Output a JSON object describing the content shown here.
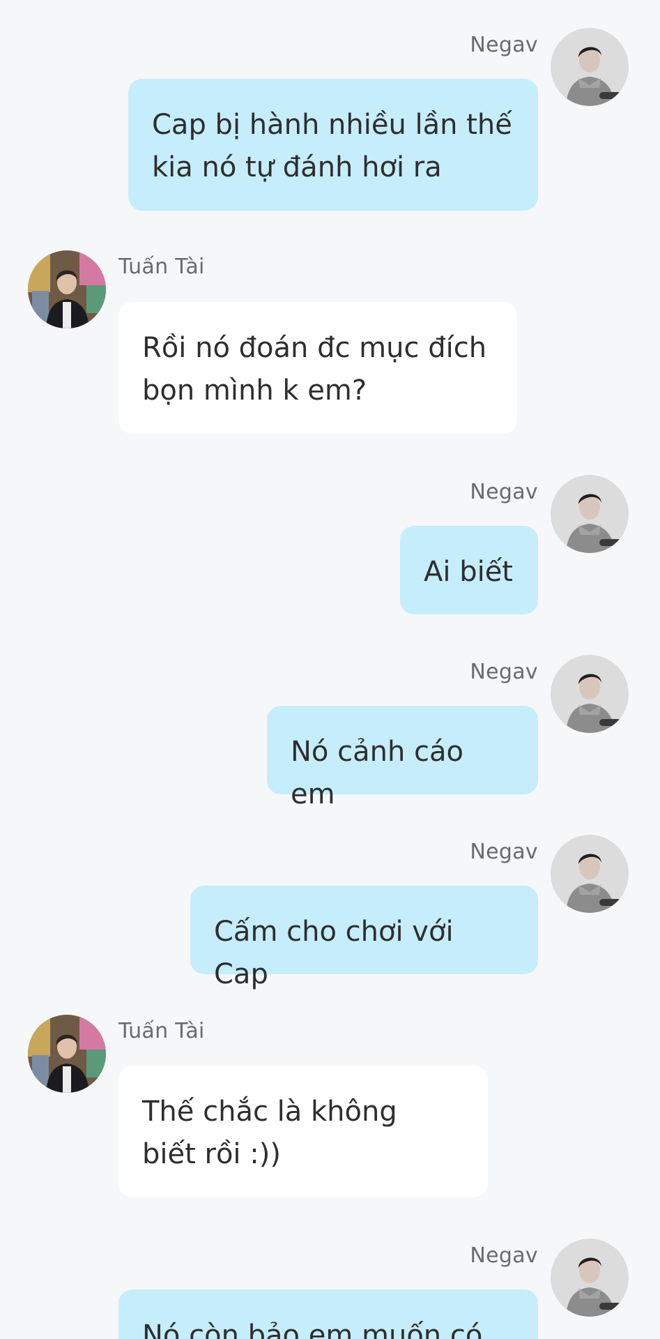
{
  "app": {
    "colors": {
      "background": "#f6f7f9",
      "outgoing_bubble": "#c6edfb",
      "incoming_bubble": "#ffffff",
      "sender_name": "#6a6a6a"
    }
  },
  "messages": [
    {
      "sender": "Negav",
      "direction": "outgoing",
      "avatar": "avatar-negav-icon",
      "text": "Cap bị hành nhiều lần thế\nkia nó tự đánh hơi ra"
    },
    {
      "sender": "Tuấn Tài",
      "direction": "incoming",
      "avatar": "avatar-tuan-tai-icon",
      "text": "Rồi nó đoán đc mục đích\nbọn mình k em?"
    },
    {
      "sender": "Negav",
      "direction": "outgoing",
      "avatar": "avatar-negav-icon",
      "text": "Ai biết"
    },
    {
      "sender": "Negav",
      "direction": "outgoing",
      "avatar": "avatar-negav-icon",
      "text": "Nó cảnh cáo em"
    },
    {
      "sender": "Negav",
      "direction": "outgoing",
      "avatar": "avatar-negav-icon",
      "text": "Cấm cho chơi với Cap"
    },
    {
      "sender": "Tuấn Tài",
      "direction": "incoming",
      "avatar": "avatar-tuan-tai-icon",
      "text": "Thế chắc là không\nbiết rồi :))"
    },
    {
      "sender": "Negav",
      "direction": "outgoing",
      "avatar": "avatar-negav-icon",
      "text": "Nó còn bảo em muốn có"
    }
  ]
}
